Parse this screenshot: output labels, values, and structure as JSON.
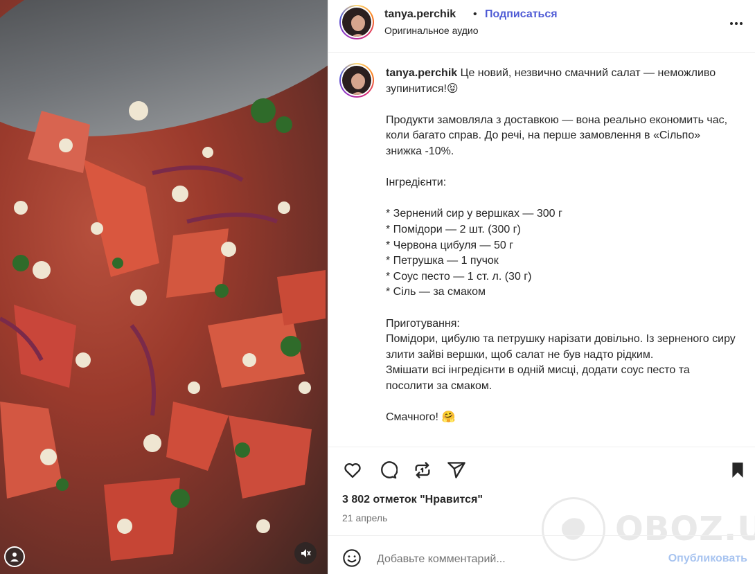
{
  "post": {
    "username": "tanya.perchik",
    "separator": "•",
    "follow_label": "Подписаться",
    "audio_label": "Оригинальное аудио",
    "more_icon": "more-horizontal-icon"
  },
  "caption": {
    "username": "tanya.perchik",
    "text": " Це новий, незвично смачний салат — неможливо зупинитися!😝\n\nПродукти замовляла з доставкою — вона реально економить час, коли багато справ. До речі, на перше замовлення в «Сільпо» знижка -10%.\n\nІнгредієнти:\n\n* Зернений сир у вершках — 300 г\n* Помідори — 2 шт. (300 г)\n* Червона цибуля — 50 г\n* Петрушка — 1 пучок\n* Соус песто — 1 ст. л. (30 г)\n* Сіль — за смаком\n\nПриготування:\nПомідори, цибулю та петрушку нарізати довільно. Із зерненого сиру злити зайві вершки, щоб салат не був надто рідким.\nЗмішати всі інгредієнти в одній мисці, додати соус песто та посолити за смаком.\n\nСмачного! 🤗"
  },
  "actions": {
    "like_icon": "heart-icon",
    "comment_icon": "comment-icon",
    "repost_icon": "repost-icon",
    "share_icon": "share-icon",
    "save_icon": "bookmark-icon"
  },
  "stats": {
    "likes": "3 802 отметок \"Нравится\"",
    "date": "21 апрель"
  },
  "comment_bar": {
    "placeholder": "Добавьте комментарий...",
    "post_label": "Опубликовать"
  },
  "watermark": {
    "text": "OBOZ.UA"
  },
  "colors": {
    "link_blue": "#4f5bd5",
    "post_disabled": "#a8c4f0",
    "muted_text": "#737373",
    "border": "#efefef"
  }
}
